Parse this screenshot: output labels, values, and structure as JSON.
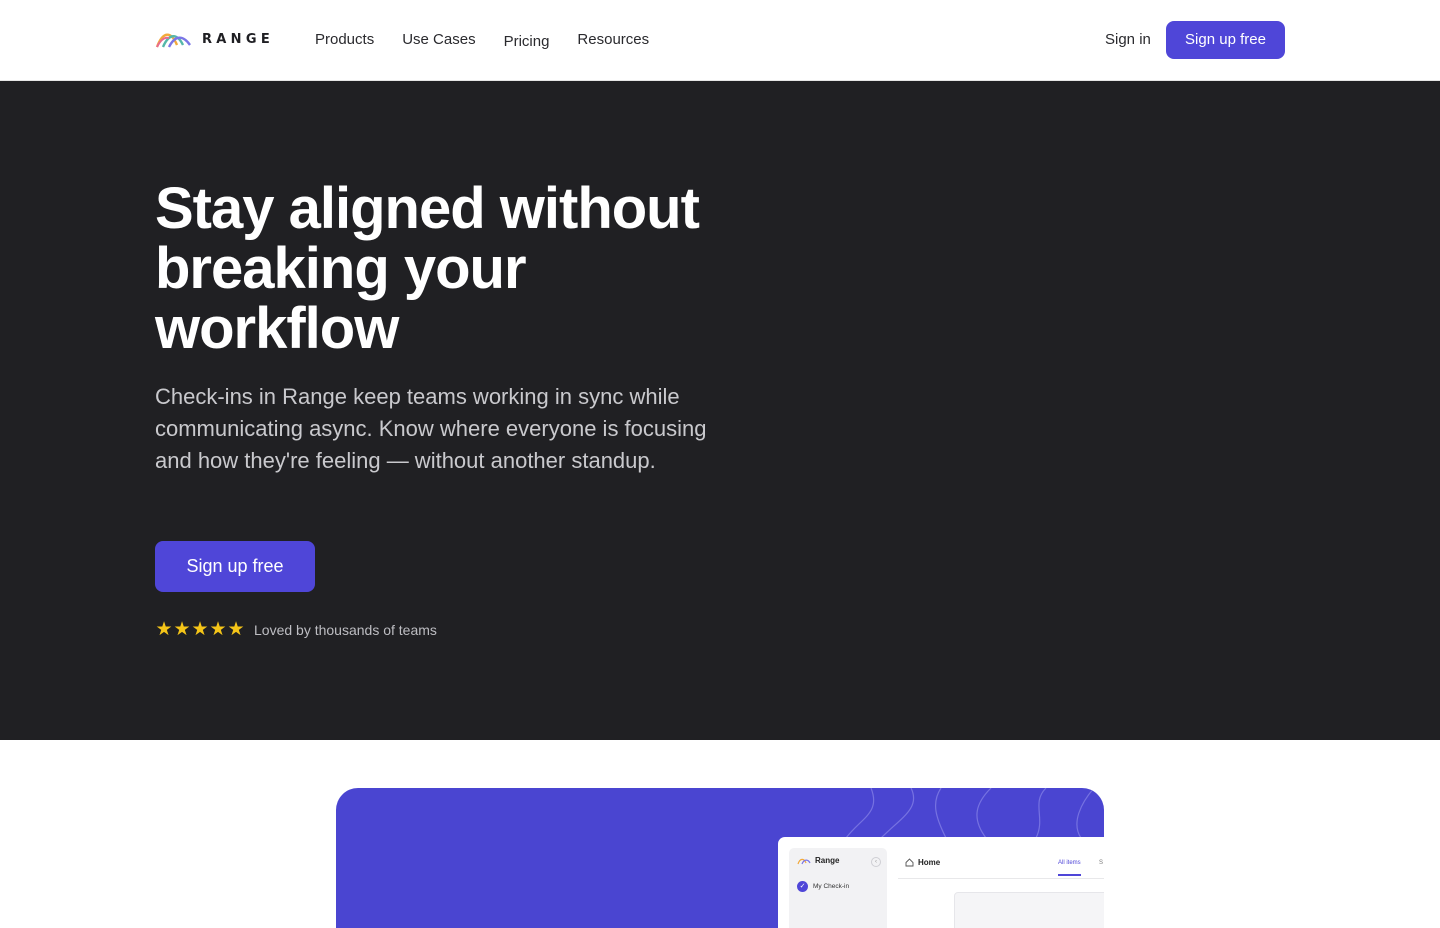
{
  "brand": {
    "name": "RANGE",
    "colors": {
      "accent": "#4f46d8",
      "hero_bg": "#202023",
      "showcase_bg": "#4a45d1",
      "star": "#f5c518"
    }
  },
  "nav": {
    "links": [
      "Products",
      "Use Cases",
      "Pricing",
      "Resources"
    ],
    "signin": "Sign in",
    "cta": "Sign up free"
  },
  "hero": {
    "title": "Stay aligned without breaking your workflow",
    "subtitle": "Check-ins in Range keep teams working in sync while communicating async. Know where everyone is focusing and how they're feeling — without another standup.",
    "cta": "Sign up free",
    "rating": {
      "stars": 5,
      "text": "Loved by thousands of teams"
    }
  },
  "app_preview": {
    "brand": "Range",
    "sidebar_item": "My Check-in",
    "page_title": "Home",
    "tab_active": "All items",
    "tab_next": "S"
  },
  "icons": [
    "range-logo-icon",
    "star-icon",
    "home-icon",
    "check-icon",
    "collapse-icon"
  ]
}
